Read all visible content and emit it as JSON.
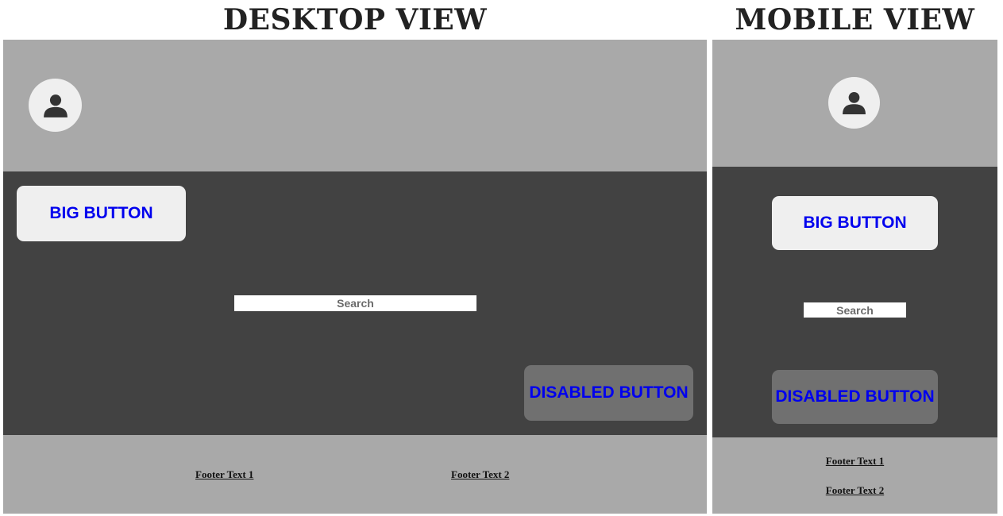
{
  "desktop": {
    "title": "DESKTOP VIEW",
    "header": {
      "avatar_icon": "user-icon"
    },
    "main": {
      "big_button": "BIG BUTTON",
      "search_placeholder": "Search",
      "disabled_button": "DISABLED BUTTON"
    },
    "footer": {
      "link_1": "Footer Text 1",
      "link_2": "Footer Text 2"
    }
  },
  "mobile": {
    "title": "MOBILE VIEW",
    "header": {
      "avatar_icon": "user-icon"
    },
    "main": {
      "big_button": "BIG BUTTON",
      "search_placeholder": "Search",
      "disabled_button": "DISABLED BUTTON"
    },
    "footer": {
      "link_1": "Footer Text 1",
      "link_2": "Footer Text 2"
    }
  },
  "colors": {
    "header_bg": "#a9a9a9",
    "main_bg": "#424242",
    "button_bg": "#efefef",
    "disabled_button_bg": "#707070",
    "button_text": "#0000ee",
    "footer_bg": "#a9a9a9",
    "avatar_bg": "#efefef",
    "avatar_icon": "#333333"
  }
}
